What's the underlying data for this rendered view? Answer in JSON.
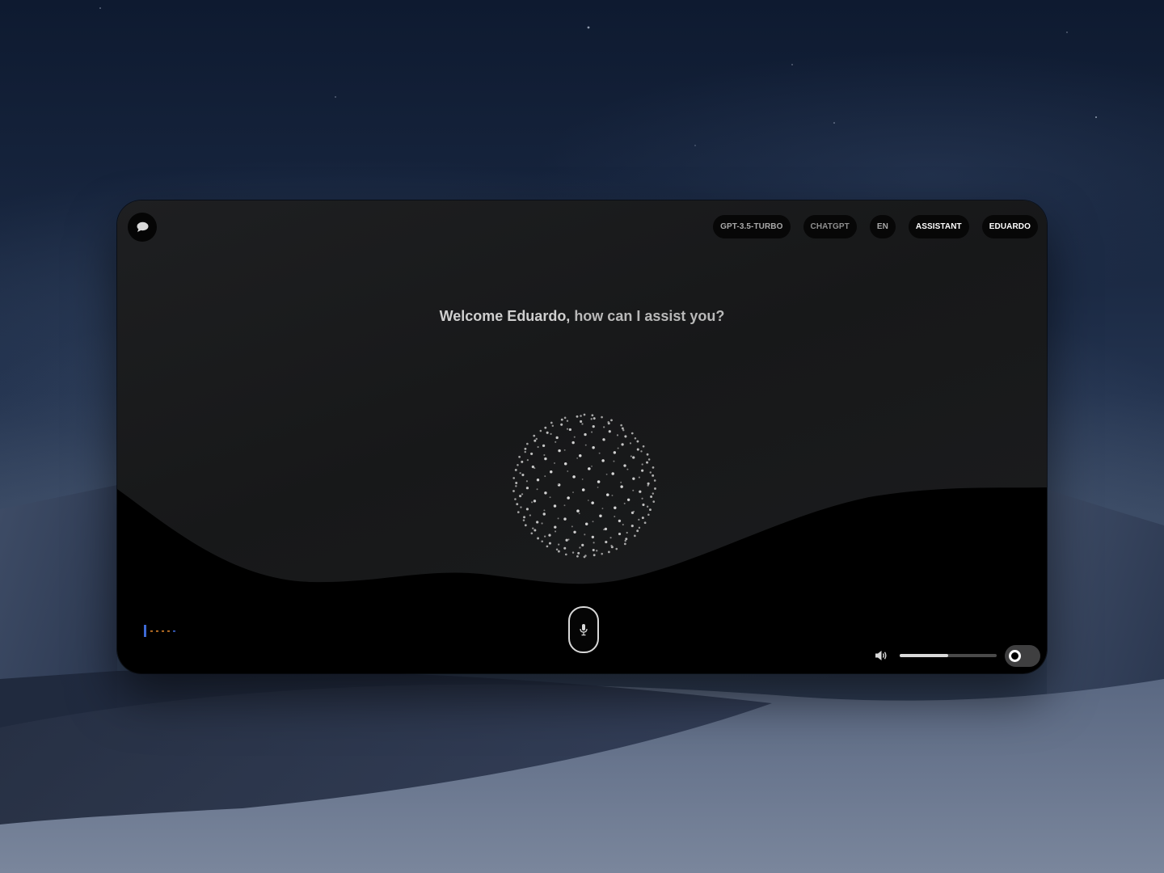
{
  "header": {
    "chat_icon": "chat-bubble-icon",
    "pills": [
      {
        "label": "GPT-3.5-TURBO"
      },
      {
        "label": "CHATGPT"
      },
      {
        "label": "EN"
      },
      {
        "label": "ASSISTANT"
      },
      {
        "label": "EDUARDO"
      }
    ]
  },
  "main": {
    "greeting_name": "Welcome Eduardo,",
    "greeting_rest": " how can I assist you?",
    "orb": "particle-sphere-visualizer"
  },
  "footer": {
    "mic_icon": "microphone-icon",
    "status_indicator": "activity-indicator",
    "volume_icon": "speaker-icon",
    "volume_level": 0.5,
    "toggle_on": false
  },
  "colors": {
    "window_bg": "#1a1b1c",
    "pill_bg": "#070707",
    "wave_fill": "#000000",
    "indicator_blue": "#3e6ad6",
    "indicator_orange": "#d9822b"
  }
}
